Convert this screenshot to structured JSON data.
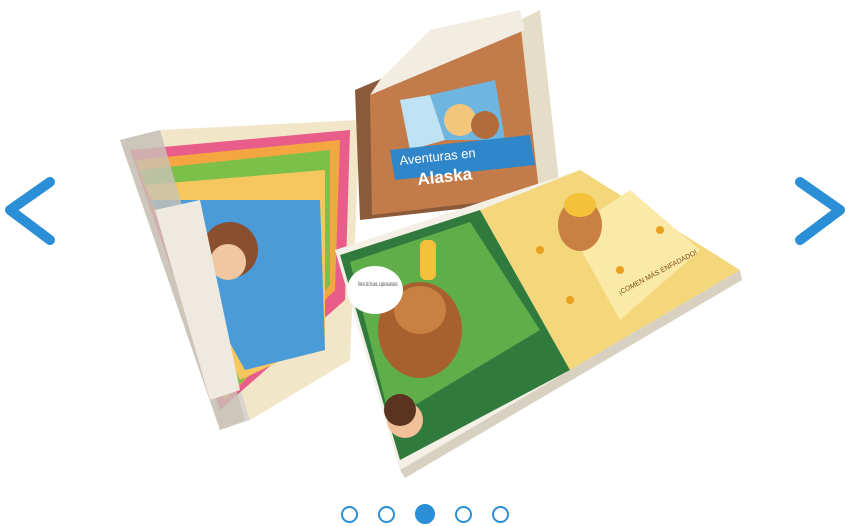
{
  "carousel": {
    "prev_icon": "chevron-left-icon",
    "next_icon": "chevron-right-icon",
    "accent_color": "#2a8fd6",
    "slide_count": 5,
    "active_index": 2
  },
  "slide": {
    "cover_title_line1": "Aventuras en",
    "cover_title_line2": "Alaska",
    "page_caption": "¡COMEN MÁS ENFADADO!",
    "speech_bubble": "Pensé ren. Sam. Se's cuenta... un aguilar una avena de oso."
  }
}
